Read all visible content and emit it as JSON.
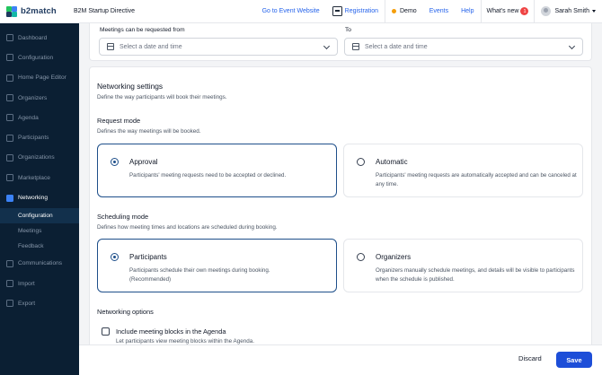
{
  "app": {
    "logo_text": "b2match",
    "event_name": "B2M Startup Directive"
  },
  "topnav": {
    "event_website": "Go to Event Website",
    "registration": "Registration",
    "demo": "Demo",
    "events": "Events",
    "help": "Help",
    "whats_new": "What's new",
    "whats_new_count": "1",
    "user_name": "Sarah Smith"
  },
  "sidebar": {
    "items": [
      {
        "label": "Dashboard",
        "icon": "dashboard-icon"
      },
      {
        "label": "Configuration",
        "icon": "gear-icon"
      },
      {
        "label": "Home Page Editor",
        "icon": "page-icon"
      },
      {
        "label": "Organizers",
        "icon": "person-icon"
      },
      {
        "label": "Agenda",
        "icon": "calendar-icon"
      },
      {
        "label": "Participants",
        "icon": "people-icon"
      },
      {
        "label": "Organizations",
        "icon": "building-icon"
      },
      {
        "label": "Marketplace",
        "icon": "store-icon"
      },
      {
        "label": "Networking",
        "icon": "handshake-icon"
      }
    ],
    "subitems": [
      {
        "label": "Configuration"
      },
      {
        "label": "Meetings"
      },
      {
        "label": "Feedback"
      }
    ],
    "bottom_items": [
      {
        "label": "Communications",
        "icon": "chat-icon"
      },
      {
        "label": "Import",
        "icon": "import-icon"
      },
      {
        "label": "Export",
        "icon": "export-icon"
      }
    ]
  },
  "meetings_period": {
    "from_label": "Meetings can be requested from",
    "to_label": "To",
    "from_placeholder": "Select a date and time",
    "to_placeholder": "Select a date and time"
  },
  "networking": {
    "title": "Networking settings",
    "subtitle": "Define the way participants will book their meetings.",
    "request_mode": {
      "title": "Request mode",
      "subtitle": "Defines the way meetings will be booked.",
      "options": [
        {
          "title": "Approval",
          "desc": "Participants' meeting requests need to be accepted or declined.",
          "selected": true
        },
        {
          "title": "Automatic",
          "desc": "Participants' meeting requests are automatically accepted and can be canceled at any time.",
          "selected": false
        }
      ]
    },
    "scheduling_mode": {
      "title": "Scheduling mode",
      "subtitle": "Defines how meeting times and locations are scheduled during booking.",
      "options": [
        {
          "title": "Participants",
          "desc": "Participants schedule their own meetings during booking. (Recommended)",
          "selected": true
        },
        {
          "title": "Organizers",
          "desc": "Organizers manually schedule meetings, and details will be visible to participants when the schedule is published.",
          "selected": false
        }
      ]
    },
    "options": {
      "title": "Networking options",
      "include_blocks_label": "Include meeting blocks in the Agenda",
      "include_blocks_desc": "Let participants view meeting blocks within the Agenda.",
      "include_blocks_checked": false
    }
  },
  "footer": {
    "discard": "Discard",
    "save": "Save"
  },
  "colors": {
    "sidebar_bg": "#0b1f33",
    "accent": "#1e4f8a",
    "save_button": "#1d4ed8",
    "demo_dot": "#f59e0b",
    "badge": "#ef4444"
  }
}
